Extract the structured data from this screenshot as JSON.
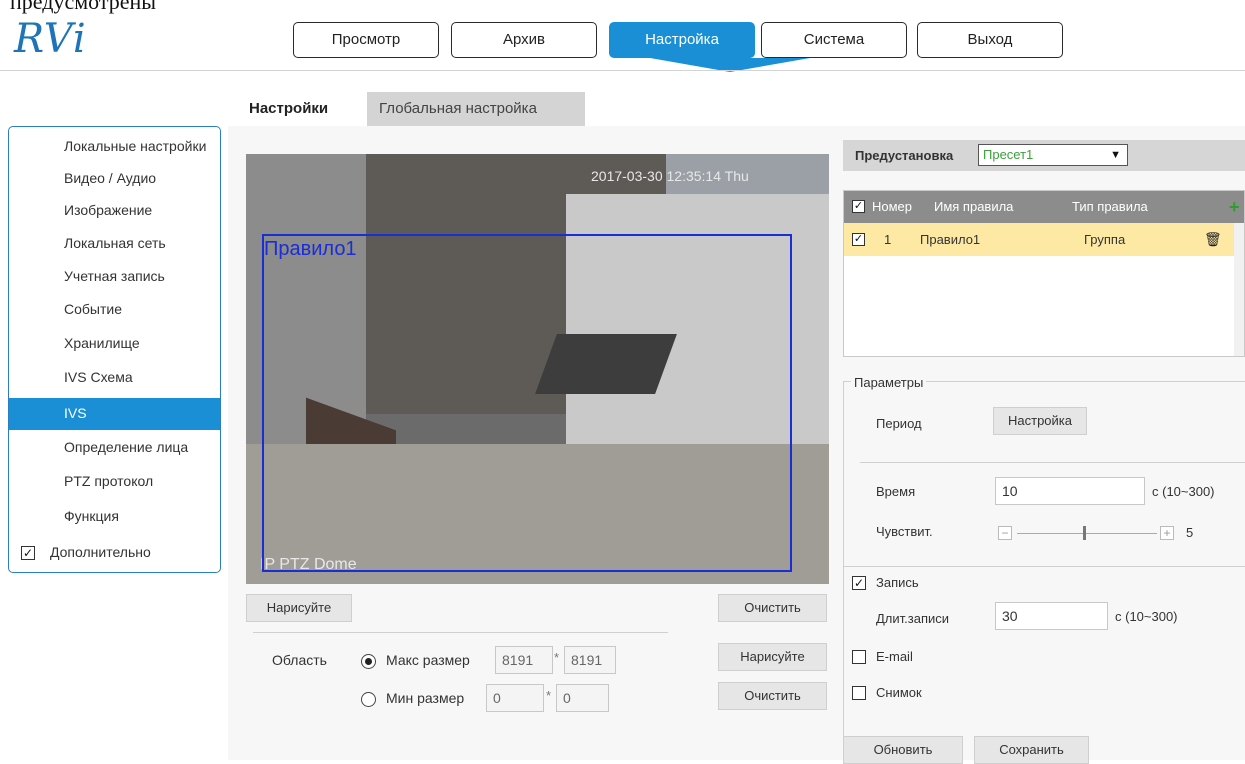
{
  "caption_text": "предусмотрены",
  "brand": {
    "logo": "RVi",
    "accent": "#1a8fd6"
  },
  "topnav": {
    "items": [
      {
        "label": "Просмотр"
      },
      {
        "label": "Архив"
      },
      {
        "label": "Настройка"
      },
      {
        "label": "Система"
      },
      {
        "label": "Выход"
      }
    ],
    "active_label": "Настройка"
  },
  "tabs": [
    {
      "label": "Настройки"
    },
    {
      "label": "Глобальная настройка"
    }
  ],
  "sidebar": {
    "items": [
      {
        "label": "Локальные настройки"
      },
      {
        "label": "Видео / Аудио"
      },
      {
        "label": "Изображение"
      },
      {
        "label": "Локальная сеть"
      },
      {
        "label": "Учетная запись"
      },
      {
        "label": "Событие"
      },
      {
        "label": "Хранилище"
      },
      {
        "label": "IVS Схема"
      },
      {
        "label": "IVS"
      },
      {
        "label": "Определение лица"
      },
      {
        "label": "PTZ протокол"
      },
      {
        "label": "Функция"
      },
      {
        "label": "Дополнительно"
      }
    ],
    "active_label": "IVS",
    "extra_checked": true
  },
  "video": {
    "timestamp": "2017-03-30 12:35:14 Thu",
    "camera_label": "IP PTZ Dome",
    "rule_label": "Правило1",
    "draw_button": "Нарисуйте",
    "clear_button": "Очистить"
  },
  "area": {
    "label": "Область",
    "max": {
      "label": "Макс размер",
      "w": "8191",
      "h": "8191",
      "selected": true
    },
    "min": {
      "label": "Мин размер",
      "w": "0",
      "h": "0",
      "selected": false
    },
    "sep": "*",
    "draw_button": "Нарисуйте",
    "clear_button": "Очистить"
  },
  "preset": {
    "label": "Предустановка",
    "value": "Пресет1"
  },
  "rules_table": {
    "headers": [
      "Номер",
      "Имя правила",
      "Тип правила"
    ],
    "rows": [
      {
        "num": "1",
        "name": "Правило1",
        "type": "Группа",
        "checked": true
      }
    ]
  },
  "params": {
    "title": "Параметры",
    "period_label": "Период",
    "period_button": "Настройка",
    "time_label": "Время",
    "time_value": "10",
    "time_unit": "с (10~300)",
    "sens_label": "Чувствит.",
    "sens_value": "5",
    "record_label": "Запись",
    "record_checked": true,
    "record_len_label": "Длит.записи",
    "record_len_value": "30",
    "record_len_unit": "с (10~300)",
    "email_label": "E-mail",
    "snapshot_label": "Снимок"
  },
  "footer": {
    "refresh": "Обновить",
    "save": "Сохранить"
  }
}
